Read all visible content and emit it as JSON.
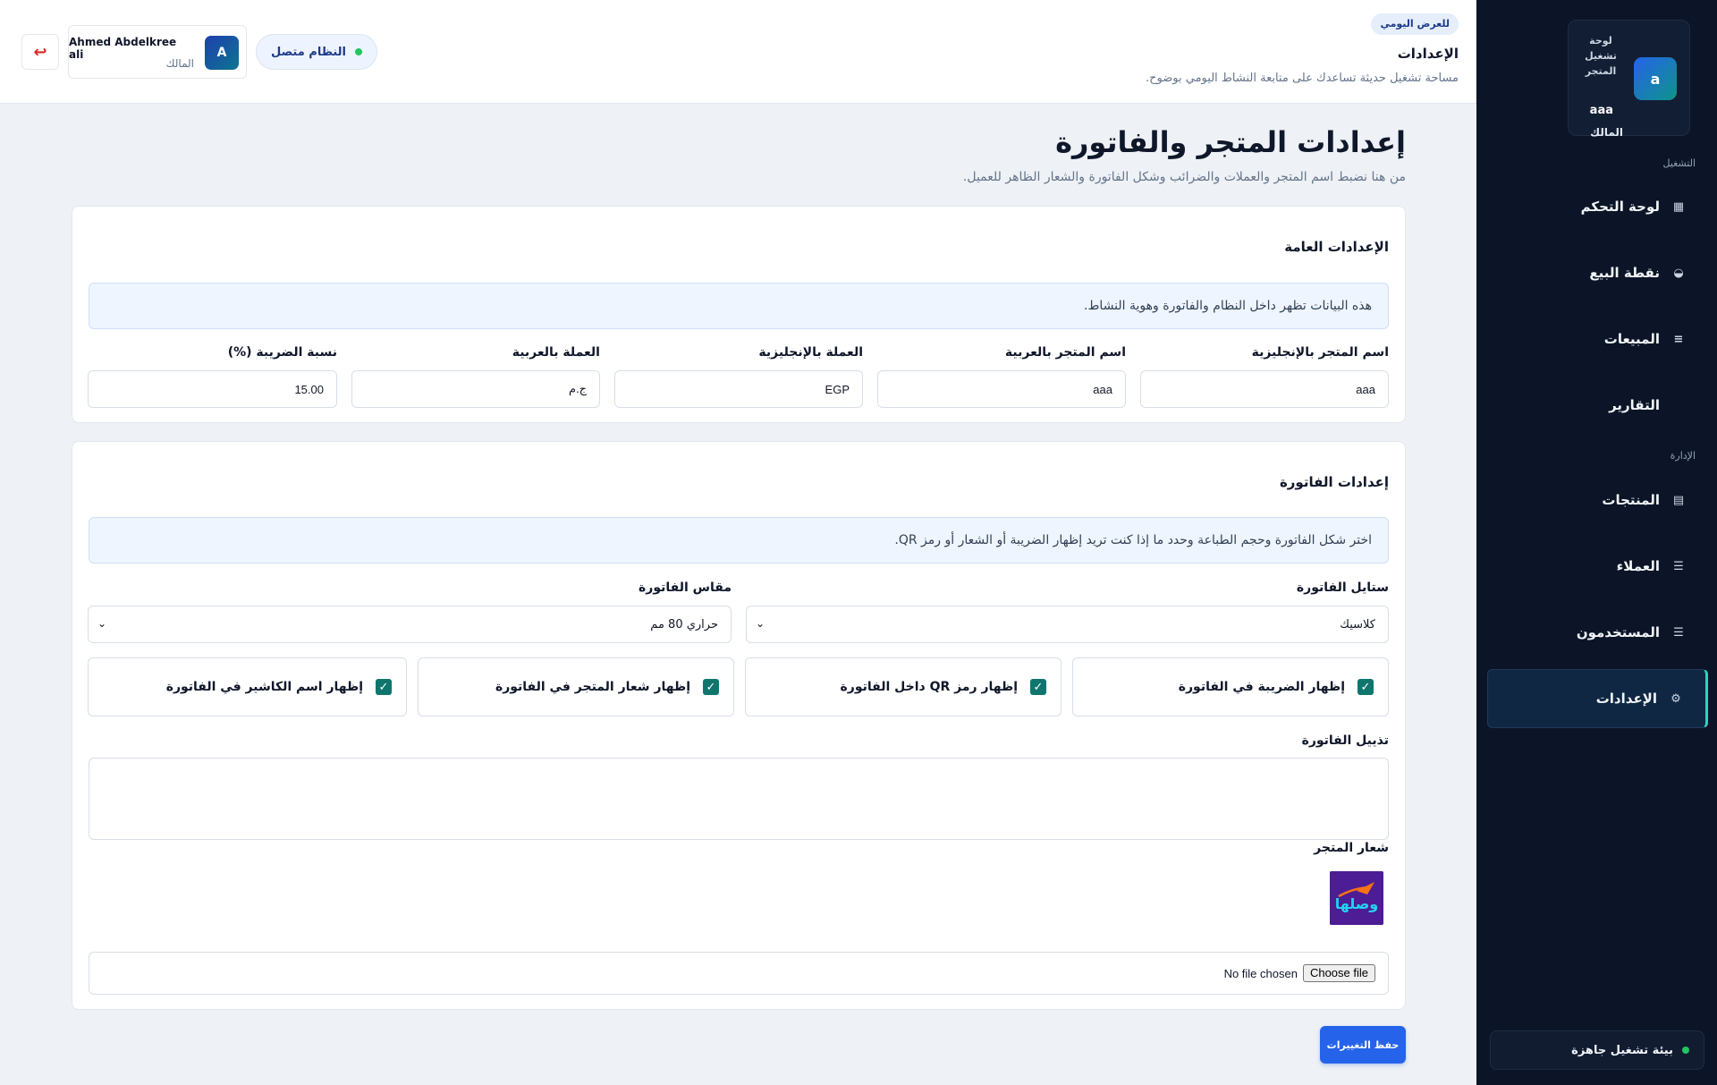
{
  "sidebar": {
    "brand": {
      "avatar_letter": "a",
      "title": "لوحة تشغيل المتجر",
      "store_name": "aaa",
      "role": "المالك"
    },
    "section_operations": "التشغيل",
    "section_management": "الإدارة",
    "items": [
      {
        "label": "لوحة التحكم",
        "icon": "▦"
      },
      {
        "label": "نقطة البيع",
        "icon": "◒"
      },
      {
        "label": "المبيعات",
        "icon": "≡"
      },
      {
        "label": "التقارير",
        "icon": ""
      },
      {
        "label": "المنتجات",
        "icon": "▤"
      },
      {
        "label": "العملاء",
        "icon": "☰"
      },
      {
        "label": "المستخدمون",
        "icon": "☰"
      },
      {
        "label": "الإعدادات",
        "icon": "⚙"
      }
    ],
    "active_item": "الإعدادات",
    "env_status": "بيئة تشغيل جاهزة",
    "env_status_color": "#22c55e"
  },
  "header": {
    "chip": "للعرض اليومي",
    "title": "الإعدادات",
    "subtitle": "مساحة تشغيل حديثة تساعدك على متابعة النشاط اليومي بوضوح.",
    "user": {
      "avatar_letter": "A",
      "name": "Ahmed Abdelkree ali",
      "role": "المالك"
    },
    "system_status": "النظام متصل",
    "logout_icon": "↩"
  },
  "page": {
    "title": "إعدادات المتجر والفاتورة",
    "subtitle": "من هنا نضبط اسم المتجر والعملات والضرائب وشكل الفاتورة والشعار الظاهر للعميل."
  },
  "general": {
    "title": "الإعدادات العامة",
    "info": "هذه البيانات تظهر داخل النظام والفاتورة وهوية النشاط.",
    "fields": [
      {
        "label": "اسم المتجر بالإنجليزية",
        "value": "aaa"
      },
      {
        "label": "اسم المتجر بالعربية",
        "value": "aaa"
      },
      {
        "label": "العملة بالإنجليزية",
        "value": "EGP"
      },
      {
        "label": "العملة بالعربية",
        "value": "ج.م"
      },
      {
        "label": "نسبة الضريبة (%)",
        "value": "15.00"
      }
    ]
  },
  "invoice": {
    "title": "إعدادات الفاتورة",
    "info": "اختر شكل الفاتورة وحجم الطباعة وحدد ما إذا كنت تريد إظهار الضريبة أو الشعار أو رمز QR.",
    "style_label": "ستايل الفاتورة",
    "style_value": "كلاسيك",
    "size_label": "مقاس الفاتورة",
    "size_value": "حراري 80 مم",
    "checks": [
      {
        "label": "إظهار الضريبة في الفاتورة",
        "checked": true
      },
      {
        "label": "إظهار رمز QR داخل الفاتورة",
        "checked": true
      },
      {
        "label": "إظهار شعار المتجر في الفاتورة",
        "checked": true
      },
      {
        "label": "إظهار اسم الكاشير في الفاتورة",
        "checked": true
      }
    ],
    "footer_label": "تذييل الفاتورة",
    "footer_value": "",
    "logo_label": "شعار المتجر",
    "logo_text": "وصلها",
    "file_status": "No file chosen",
    "file_button": "Choose file"
  },
  "save_button": "حفظ التغييرات",
  "colors": {
    "accent": "#2563eb",
    "sidebar_bg": "#0b1527",
    "active_border": "#2dd4bf",
    "check": "#0f766e"
  }
}
